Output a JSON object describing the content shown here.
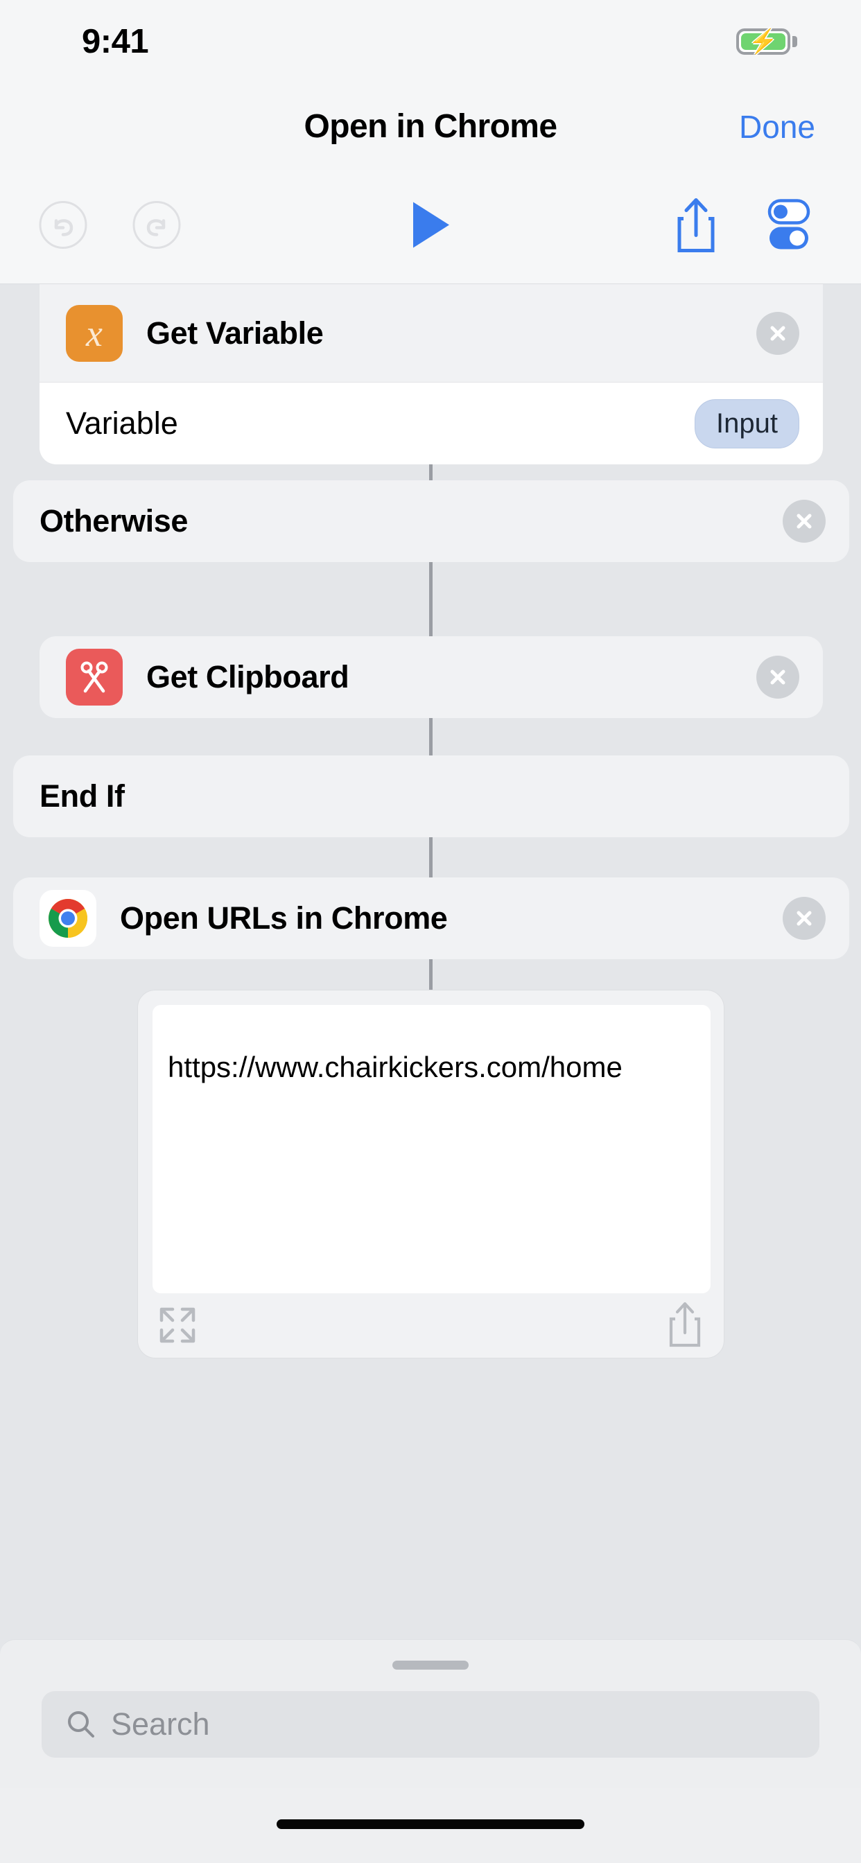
{
  "status_bar": {
    "time": "9:41",
    "battery_icon": "battery-charging-icon"
  },
  "nav_bar": {
    "title": "Open in Chrome",
    "done_label": "Done"
  },
  "toolbar": {
    "undo_icon": "undo-icon",
    "redo_icon": "redo-icon",
    "run_icon": "play-icon",
    "share_icon": "share-icon",
    "settings_icon": "toggles-icon"
  },
  "actions": [
    {
      "id": "get-variable",
      "title": "Get Variable",
      "icon": "variable-x-icon",
      "icon_color": "#e8912f",
      "delete_icon": "close-circle-icon",
      "params": [
        {
          "label": "Variable",
          "value": "Input"
        }
      ]
    },
    {
      "id": "otherwise",
      "title": "Otherwise",
      "icon": null,
      "delete_icon": "close-circle-icon"
    },
    {
      "id": "get-clipboard",
      "title": "Get Clipboard",
      "icon": "scissors-icon",
      "icon_color": "#ea5a5a",
      "delete_icon": "close-circle-icon"
    },
    {
      "id": "end-if",
      "title": "End If",
      "icon": null,
      "delete_icon": null
    },
    {
      "id": "open-urls-in-chrome",
      "title": "Open URLs in Chrome",
      "icon": "chrome-logo-icon",
      "icon_color": "#ffffff",
      "delete_icon": "close-circle-icon"
    }
  ],
  "preview": {
    "url": "https://www.chairkickers.com/home",
    "expand_icon": "expand-arrows-icon",
    "share_icon": "share-icon"
  },
  "bottom_sheet": {
    "grabber": "drag-handle",
    "search_placeholder": "Search",
    "search_value": "",
    "search_icon": "search-icon"
  },
  "home_indicator": "home-indicator",
  "colors": {
    "accent": "#3a7ced",
    "background": "#e4e6e9",
    "card": "#f1f2f4",
    "chip": "#c9d7ee",
    "connector": "#9a9da3"
  }
}
